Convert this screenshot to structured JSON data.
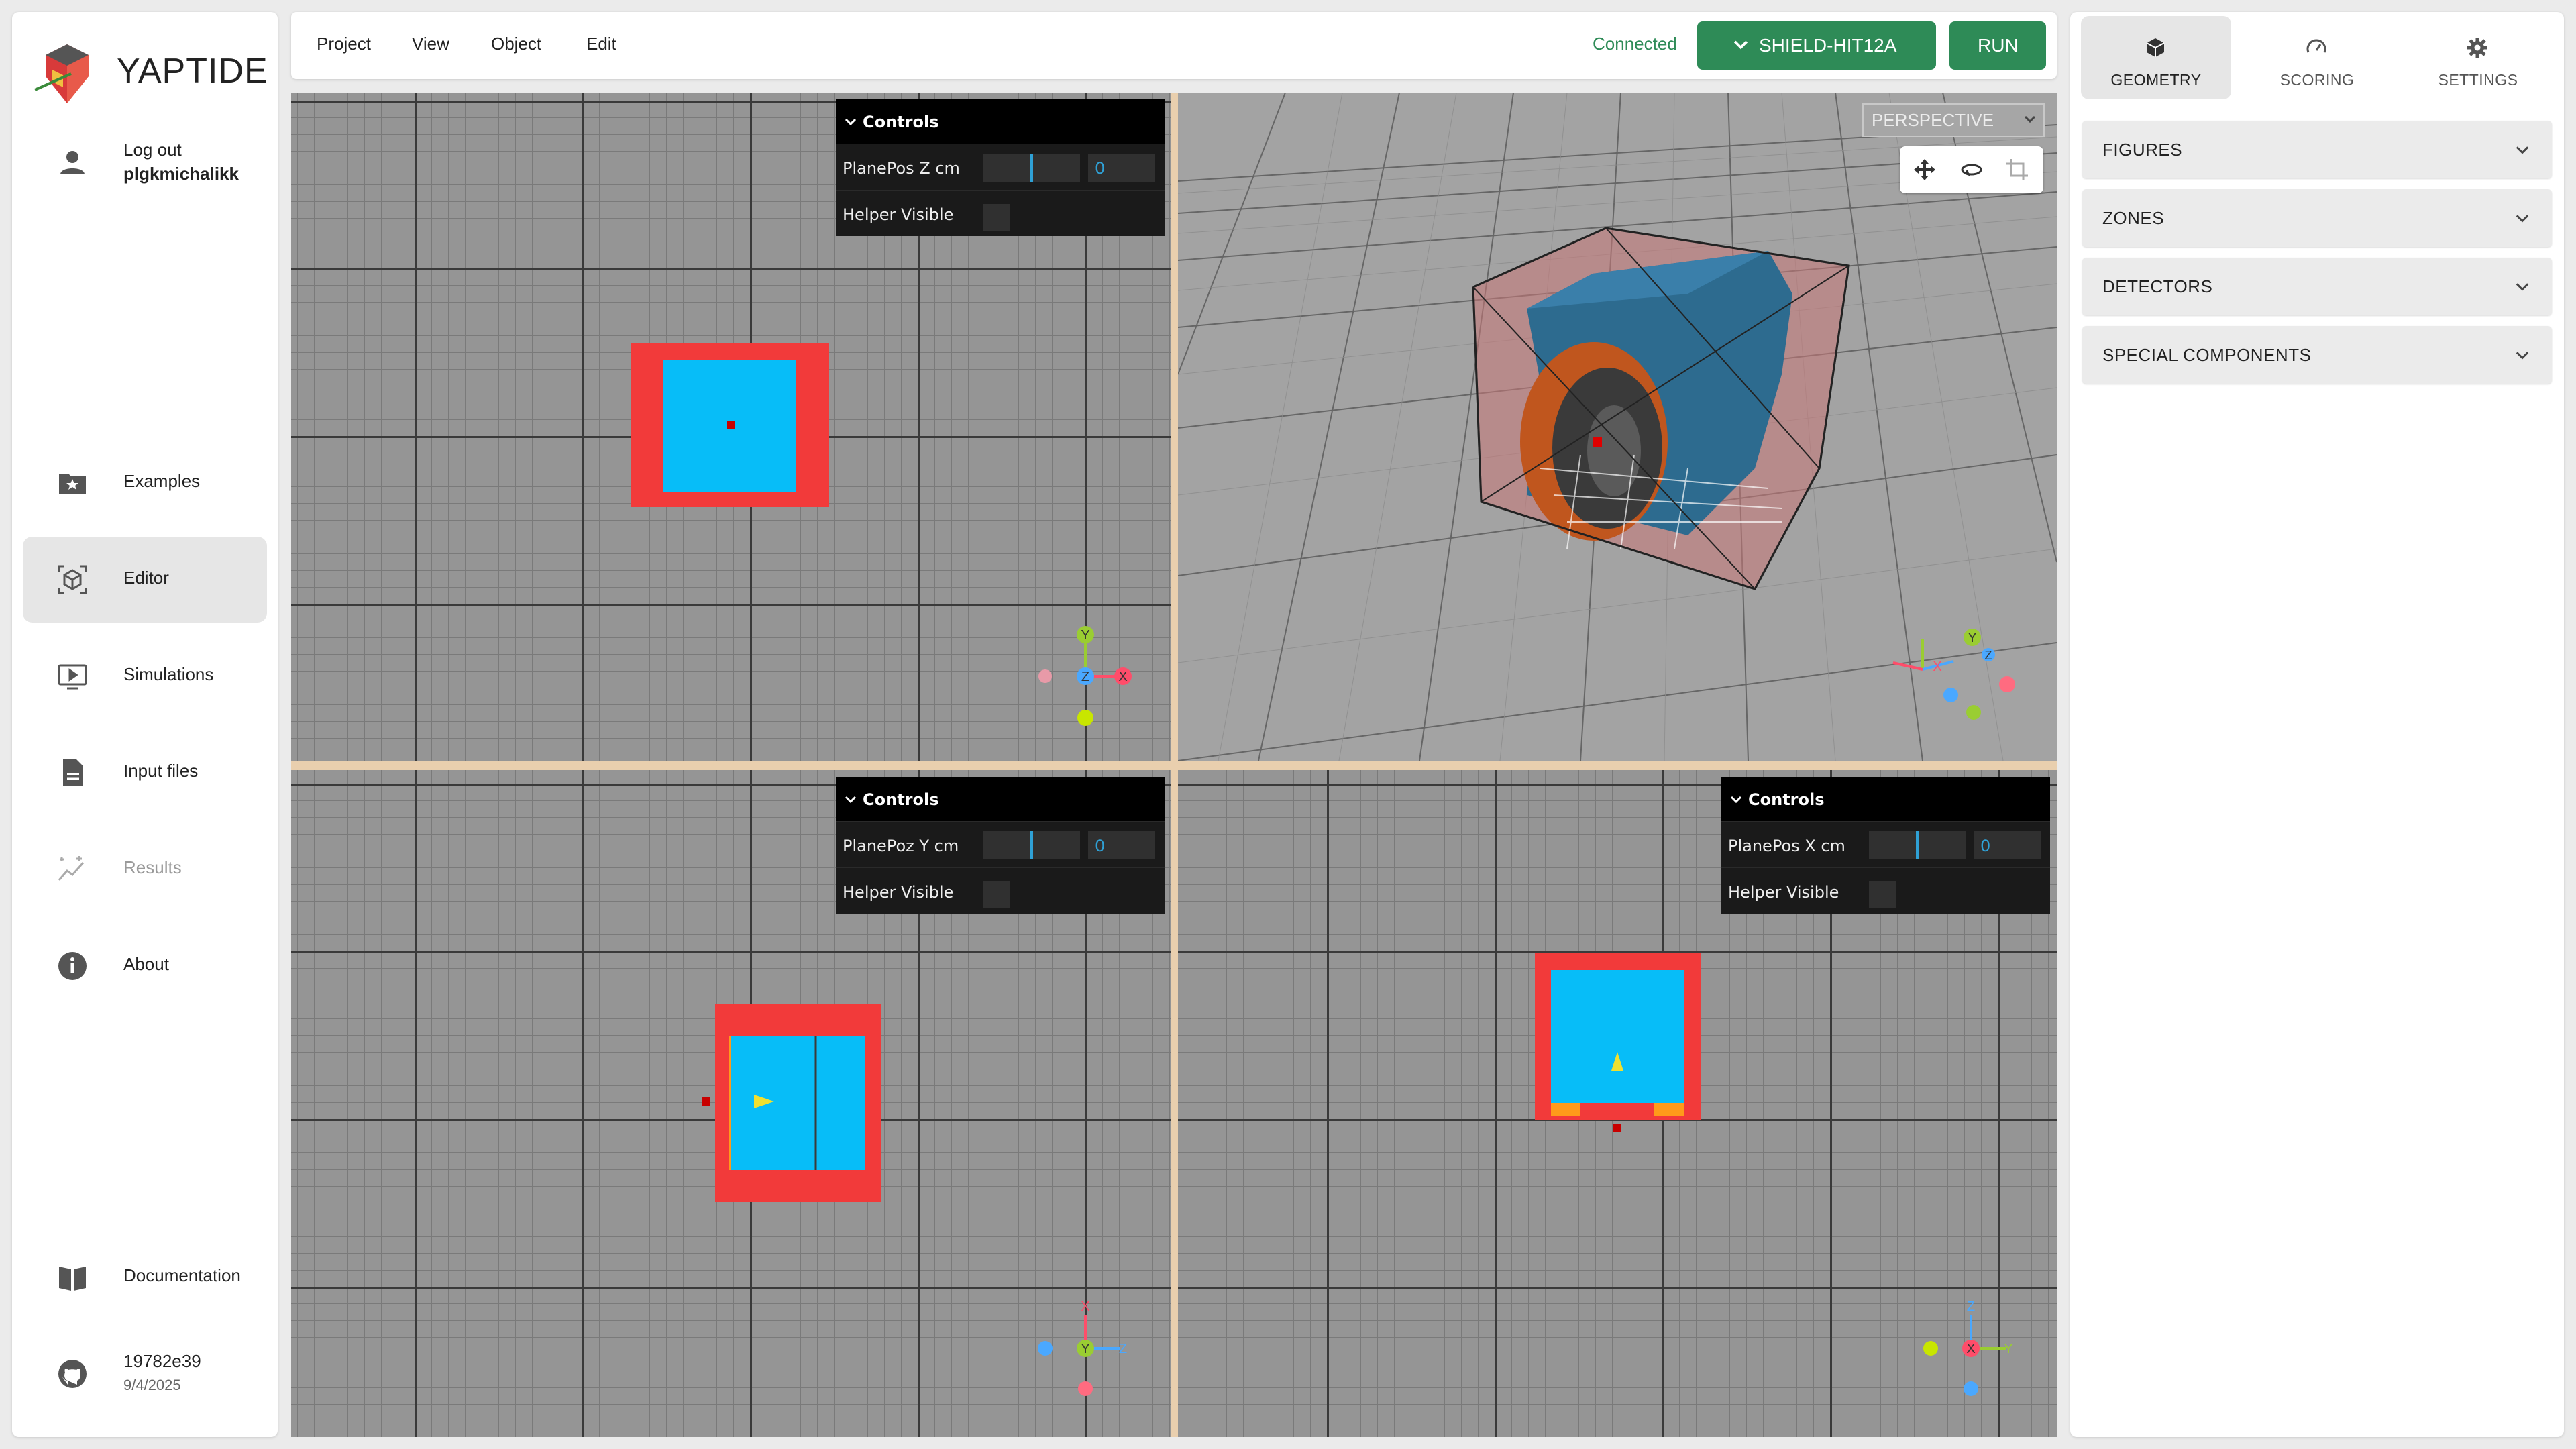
{
  "app": {
    "name": "YAPTIDE"
  },
  "sidebar": {
    "user": {
      "action": "Log out",
      "username": "plgkmichalikk"
    },
    "nav": [
      {
        "label": "Examples",
        "icon": "folder-star-icon",
        "active": false,
        "disabled": false
      },
      {
        "label": "Editor",
        "icon": "cube-scan-icon",
        "active": true,
        "disabled": false
      },
      {
        "label": "Simulations",
        "icon": "play-monitor-icon",
        "active": false,
        "disabled": false
      },
      {
        "label": "Input files",
        "icon": "document-icon",
        "active": false,
        "disabled": false
      },
      {
        "label": "Results",
        "icon": "chart-sparkle-icon",
        "active": false,
        "disabled": true
      },
      {
        "label": "About",
        "icon": "info-icon",
        "active": false,
        "disabled": false
      }
    ],
    "documentation": "Documentation",
    "version": {
      "hash": "19782e39",
      "date": "9/4/2025"
    }
  },
  "topbar": {
    "menus": [
      "Project",
      "View",
      "Object",
      "Edit"
    ],
    "status": "Connected",
    "simulator": "SHIELD-HIT12A",
    "run": "RUN"
  },
  "viewports": {
    "top_left": {
      "controls_title": "Controls",
      "plane_label": "PlanePos Z cm",
      "plane_value": "0",
      "helper_label": "Helper Visible"
    },
    "bottom_left": {
      "controls_title": "Controls",
      "plane_label": "PlanePoz Y cm",
      "plane_value": "0",
      "helper_label": "Helper Visible"
    },
    "bottom_right": {
      "controls_title": "Controls",
      "plane_label": "PlanePos X cm",
      "plane_value": "0",
      "helper_label": "Helper Visible"
    },
    "top_right": {
      "camera_mode": "PERSPECTIVE"
    }
  },
  "axes": {
    "x": "X",
    "y": "Y",
    "z": "Z"
  },
  "right_panel": {
    "tabs": [
      {
        "label": "GEOMETRY",
        "icon": "cube-icon",
        "active": true
      },
      {
        "label": "SCORING",
        "icon": "gauge-icon",
        "active": false
      },
      {
        "label": "SETTINGS",
        "icon": "gear-icon",
        "active": false
      }
    ],
    "sections": [
      "FIGURES",
      "ZONES",
      "DETECTORS",
      "SPECIAL COMPONENTS"
    ]
  },
  "colors": {
    "accent_green": "#2e8b57",
    "figure_blue": "#07bdf8",
    "zone_red": "#f23a3a",
    "zone_orange": "#ff9a1a",
    "controls_blue": "#2fa1d6",
    "divider": "#e9cfae"
  }
}
